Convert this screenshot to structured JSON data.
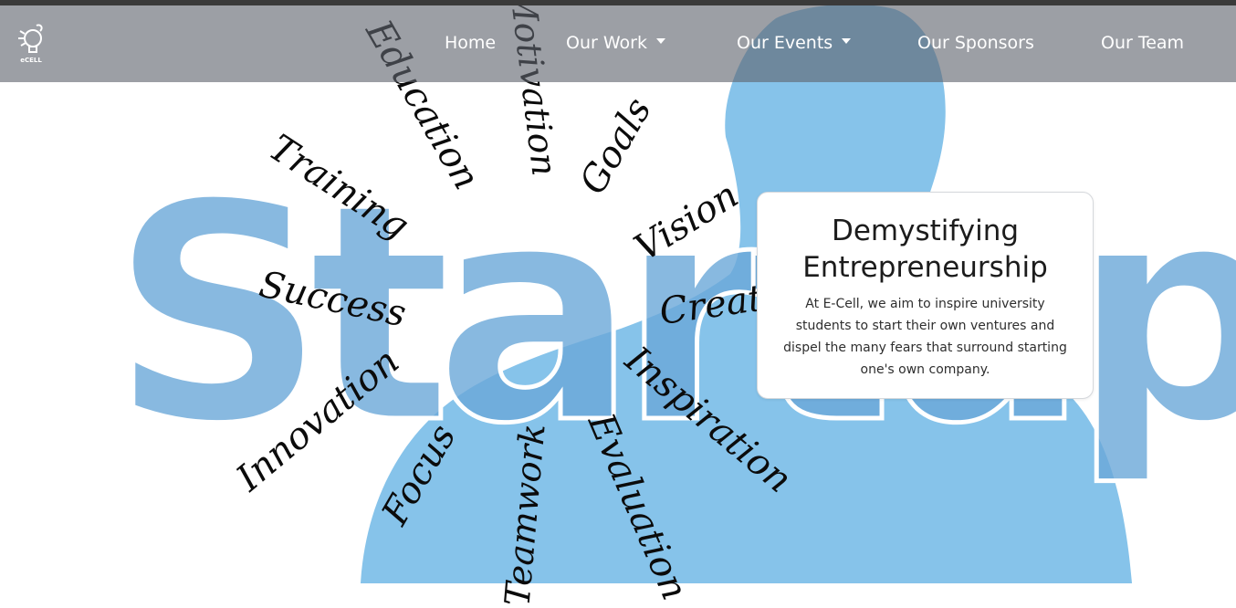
{
  "nav": {
    "logo_text": "eCELL",
    "items": [
      {
        "label": "Home",
        "dropdown": false
      },
      {
        "label": "Our Work",
        "dropdown": true
      },
      {
        "label": "Our Events",
        "dropdown": true
      },
      {
        "label": "Our Sponsors",
        "dropdown": false
      },
      {
        "label": "Our Team",
        "dropdown": false
      }
    ]
  },
  "hero": {
    "big_word": "Startup",
    "words": [
      "Education",
      "Motivation",
      "Goals",
      "Training",
      "Vision",
      "Success",
      "Creation",
      "Innovation",
      "Inspiration",
      "Focus",
      "Teamwork",
      "Evaluation"
    ]
  },
  "card": {
    "title_line1": "Demystifying",
    "title_line2": "Entrepreneurship",
    "text": "At E-Cell, we aim to inspire university students to start their own ventures and dispel the many fears that surround starting one's own company."
  },
  "colors": {
    "navbar": "#5f646e",
    "silhouette": "#86c3ea",
    "startup_letters": "#6aa8d8",
    "text_dark": "#1c1c1c"
  }
}
